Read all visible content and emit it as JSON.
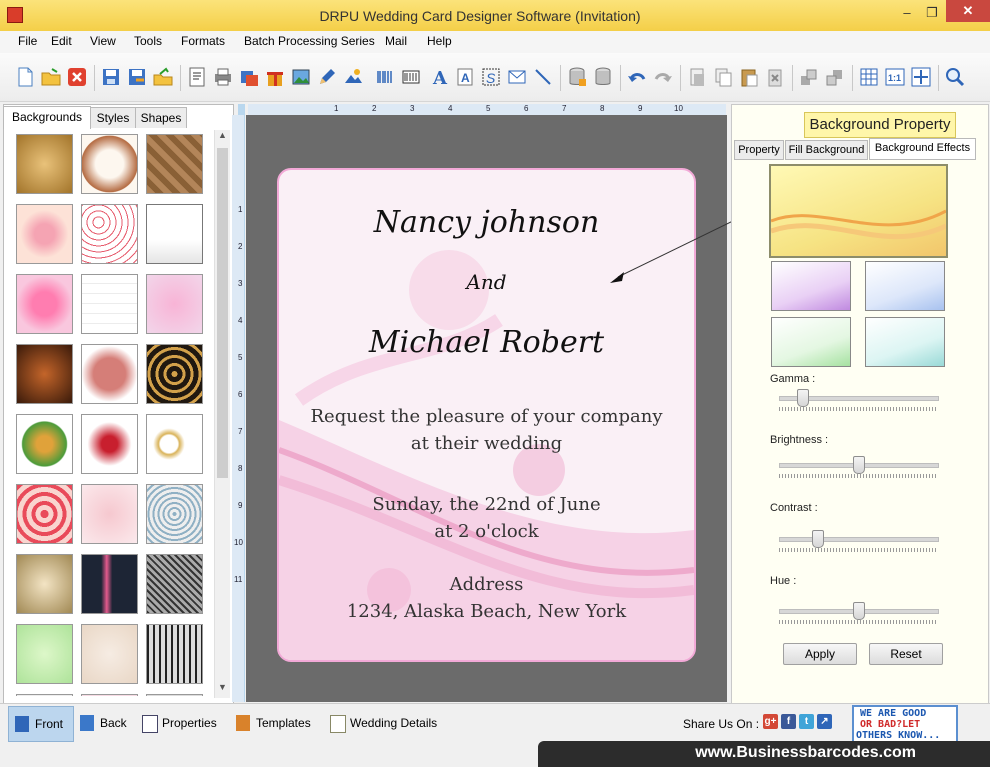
{
  "window": {
    "title": "DRPU Wedding Card Designer Software (Invitation)",
    "controls": {
      "minimize": "–",
      "maximize": "❐",
      "close": "✕"
    }
  },
  "menu": [
    "File",
    "Edit",
    "View",
    "Tools",
    "Formats",
    "Batch Processing Series",
    "Mail",
    "Help"
  ],
  "toolbar_icons": [
    "new-file-icon",
    "open-folder-icon",
    "close-icon",
    "save-icon",
    "save-as-icon",
    "export-icon",
    "properties-icon",
    "print-icon",
    "print-preview-icon",
    "gift-icon",
    "image-icon",
    "pencil-icon",
    "picture-icon",
    "barcode-icon",
    "barcode-alt-icon",
    "text-icon",
    "word-art-icon",
    "signature-icon",
    "mail-icon",
    "line-icon",
    "database-icon",
    "database-alt-icon",
    "undo-icon",
    "redo-icon",
    "cut-icon",
    "copy-icon",
    "paste-icon",
    "delete-icon",
    "bring-front-icon",
    "send-back-icon",
    "grid-icon",
    "actual-size-icon",
    "fit-window-icon",
    "zoom-icon"
  ],
  "left_panel": {
    "tabs": [
      "Backgrounds",
      "Styles",
      "Shapes"
    ],
    "active_tab": "Backgrounds"
  },
  "ruler": {
    "h_ticks": [
      "1",
      "2",
      "3",
      "4",
      "5",
      "6",
      "7",
      "8",
      "9",
      "10"
    ],
    "v_ticks": [
      "1",
      "2",
      "3",
      "4",
      "5",
      "6",
      "7",
      "8",
      "9",
      "10",
      "11"
    ]
  },
  "card": {
    "name1": "Nancy johnson",
    "and": "And",
    "name2": "Michael Robert",
    "line1": "Request the pleasure of your company",
    "line2": "at their wedding",
    "date": "Sunday, the 22nd of June",
    "time": "at 2 o'clock",
    "address_label": "Address",
    "address": "1234, Alaska Beach, New York"
  },
  "right_panel": {
    "tooltip": "Background Property",
    "tabs": [
      "Property",
      "Fill Background",
      "Background Effects"
    ],
    "active_tab": "Background Effects",
    "sliders": [
      {
        "label": "Gamma :",
        "value": 0.12
      },
      {
        "label": "Brightness :",
        "value": 0.5
      },
      {
        "label": "Contrast :",
        "value": 0.22
      },
      {
        "label": "Hue :",
        "value": 0.5
      }
    ],
    "apply": "Apply",
    "reset": "Reset"
  },
  "bottom": {
    "buttons": [
      "Front",
      "Back",
      "Properties",
      "Templates",
      "Wedding Details"
    ],
    "active": "Front",
    "share_label": "Share Us On :",
    "promo_lines": [
      "WE ARE GOOD",
      "OR BAD?LET",
      "OTHERS KNOW..."
    ],
    "footer": "www.Businessbarcodes.com"
  }
}
